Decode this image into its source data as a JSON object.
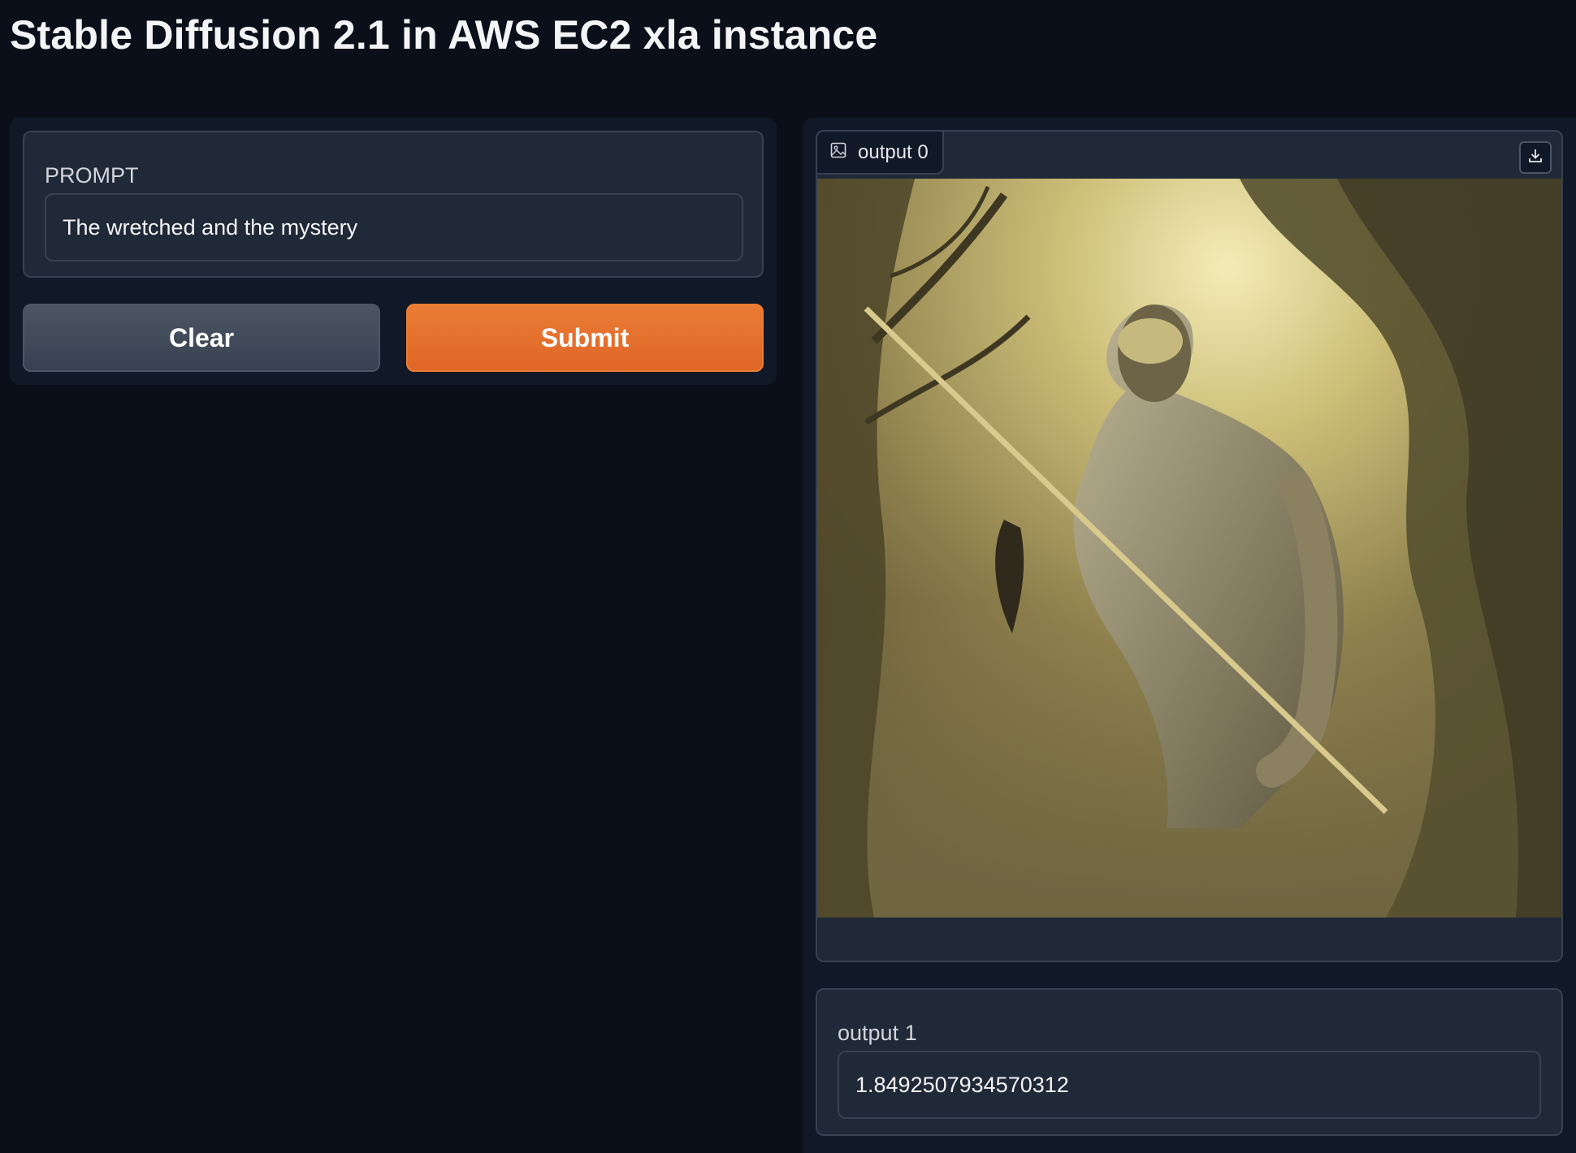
{
  "header": {
    "title": "Stable Diffusion 2.1 in AWS EC2 xla instance"
  },
  "input_panel": {
    "prompt_label": "PROMPT",
    "prompt_value": "The wretched and the mystery",
    "clear_label": "Clear",
    "submit_label": "Submit"
  },
  "output_panel": {
    "image_tab_label": "output 0",
    "image_icon": "image-icon",
    "download_icon": "download-icon",
    "image_description_icon": "generated-image",
    "output1_label": "output 1",
    "output1_value": "1.8492507934570312"
  },
  "colors": {
    "background": "#0b0f19",
    "panel": "#111827",
    "block": "#1f2937",
    "border": "#374151",
    "submit": "#e2702d",
    "clear": "#4b5563"
  }
}
